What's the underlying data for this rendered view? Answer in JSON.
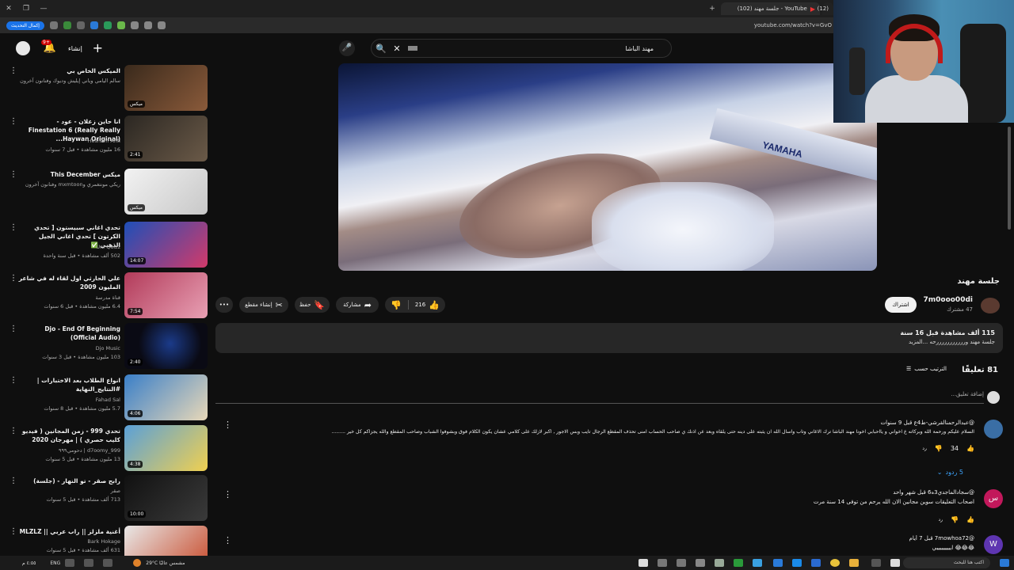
{
  "browser": {
    "tabs": [
      {
        "title": "YouTube - جلسة مهند (102)",
        "active": true
      },
      {
        "title": "(12)",
        "active": false
      }
    ],
    "update_label": "إكمال التحديث",
    "url": "youtube.com/watch?v=GvO"
  },
  "topnav": {
    "notification_count": "9+",
    "create_label": "إنشاء",
    "search_value": "مهند الباشا"
  },
  "video": {
    "player_brand": "YAMAHA",
    "title": "جلسة مهند",
    "channel_name": "7m0ooo00di",
    "channel_subs": "47 مشترك",
    "subscribe_label": "اشتراك",
    "like_count": "216",
    "share_label": "مشاركة",
    "save_label": "حفظ",
    "clip_label": "إنشاء مقطع",
    "more_label": "•••",
    "description": {
      "stats": "115 ألف مشاهدة قبل 16 سنة",
      "text": "جلسة مهند ورررررررررررحه ...المزيد"
    }
  },
  "comments": {
    "count_label": "81 تعليقًا",
    "sort_label": "الترتيب حسب",
    "add_placeholder": "إضافة تعليق...",
    "items": [
      {
        "author": "@عبدالرحمنالقرشي-ط4ع قبل 9 سنوات",
        "text": "السلام عليكم ورحمة الله وبركاته ع اخواني و يااحبابي اخونا مهند الباشا ترك الاغاني وتاب واسال الله ان يثبته على دينه حتى يلقاه وبعد عن اذنك ي صاحب الحساب امنى تحذف المقطع الرجال تايب وبس الاجور , اكبر لازلك على كلامي عشان يكون الكلام فوق وبشوفوا الشباب وصاحب المقطع والله يجزاكم كل خير .........",
        "likes": "34",
        "replies_label": "5 ردود",
        "avatar_color": "#3a6ea5"
      },
      {
        "author": "@سجادالماجدي3ه6 قبل شهر واحد",
        "text": "اصحاب التعليقات سوين مجانين الان الله يرحم من توفى 14 سنة مرت",
        "avatar_letter": "س",
        "avatar_color": "#c2185b"
      },
      {
        "author": "@7mowhoa72 قبل 7 أيام",
        "text": "😂😂😂 ايييييييييي",
        "avatar_letter": "W",
        "avatar_color": "#5e35b1"
      }
    ]
  },
  "sidebar": {
    "items": [
      {
        "title": "الميكس الخاص بي",
        "channel": "سالم اليامي وياني إيليش وديوك وفنانون آخرون",
        "meta": "",
        "duration": "ميكس",
        "thumb": [
          "#3a2a1c",
          "#8a5a3a"
        ]
      },
      {
        "title": "انا حاين زعلان - عود - Finestation 6 (Really Really Haywan Original)...",
        "channel": "Hesham Afifi",
        "meta": "16 مليون مشاهدة • قبل 7 سنوات",
        "duration": "2:41",
        "thumb": [
          "#2b2722",
          "#6b5a48"
        ]
      },
      {
        "title": "ميكس This December",
        "channel": "ريكي مونتغمري وmxmtoon وفنانون آخرون",
        "meta": "",
        "duration": "ميكس",
        "thumb": [
          "#f2f2f2",
          "#c8c8c8"
        ]
      },
      {
        "title": "تحدي اغاني سبيستون [ تحدي الكرتون ] تحدي اغاني الجيل الذهبي ✅",
        "channel": "Uni Quizz",
        "meta": "502 ألف مشاهدة • قبل سنة واحدة",
        "duration": "14:07",
        "thumb": [
          "#1e4fb8",
          "#d23a6a"
        ]
      },
      {
        "title": "علي الحارثي اول لقاء له في شاعر المليون 2009",
        "channel": "قناة مدرسة",
        "meta": "6.4 مليون مشاهدة • قبل 6 سنوات",
        "duration": "7:54",
        "thumb": [
          "#b23b5a",
          "#e8a0b4"
        ]
      },
      {
        "title": "Djo - End Of Beginning (Official Audio)",
        "channel": "Djo Music",
        "meta": "103 مليون مشاهدة • قبل 3 سنوات",
        "duration": "2:40",
        "thumb": [
          "#0a0a14",
          "#1b3b8a"
        ]
      },
      {
        "title": "انواع الطلاب بعد الاختبارات | #النتايج_النهاية",
        "channel": "Fahad Sal",
        "meta": "5.7 مليون مشاهدة • قبل 8 سنوات",
        "duration": "4:06",
        "thumb": [
          "#3a7fc8",
          "#e8d8b8"
        ]
      },
      {
        "title": "تحدي 999 - زمن المجانين ( فيديو كليب حصري ) | مهرجان 2020",
        "channel": "d7oomy_999 | دحومي٩٩٩",
        "meta": "13 مليون مشاهدة • قبل 5 سنوات",
        "duration": "4:38",
        "thumb": [
          "#5aa0d8",
          "#f0d050"
        ]
      },
      {
        "title": "رابح صقر - تو النهار - (جلسة)",
        "channel": "صقر",
        "meta": "713 ألف مشاهدة • قبل 5 سنوات",
        "duration": "10:00",
        "thumb": [
          "#111111",
          "#3a3a3a"
        ]
      },
      {
        "title": "أغنية ملزلز || راب عربي || MLZLZ",
        "channel": "Bark Hokage",
        "meta": "631 ألف مشاهدة • قبل 5 سنوات",
        "duration": "",
        "thumb": [
          "#e8e8e8",
          "#c84a2a"
        ]
      }
    ]
  },
  "taskbar": {
    "weather": "29°C مشمس عالبًا",
    "search_placeholder": "اكتب هنا للبحث",
    "lang": "ENG",
    "clock": "٤:٥٥ م"
  }
}
